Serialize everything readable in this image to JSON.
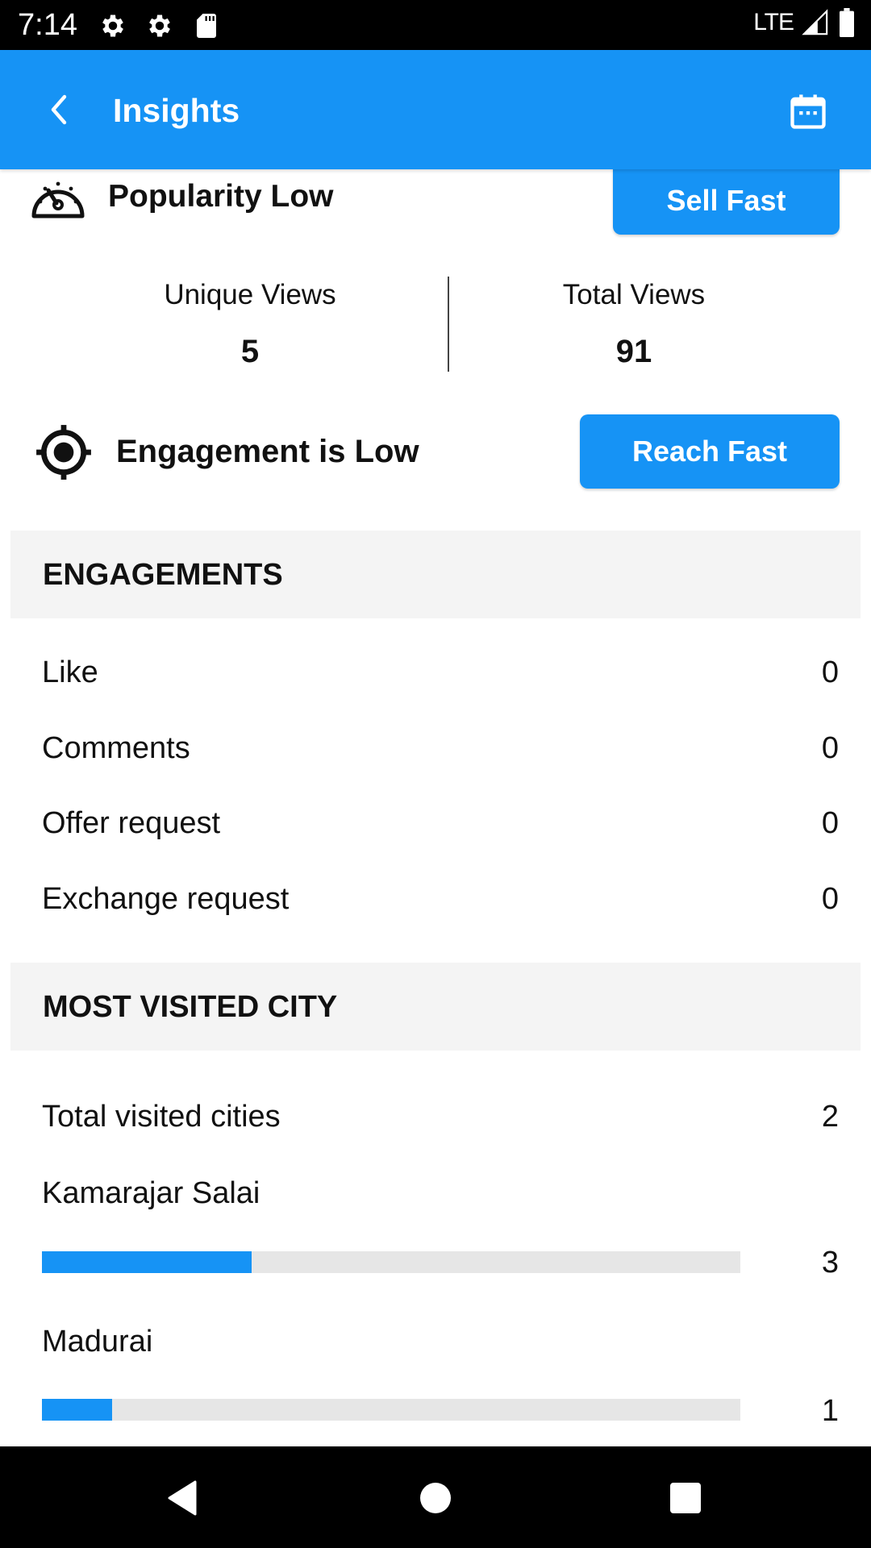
{
  "status_bar": {
    "time": "7:14",
    "left_icons": [
      "settings-icon",
      "settings-icon",
      "sd-card-icon"
    ],
    "network": "LTE",
    "right_icons": [
      "signal-icon",
      "battery-icon"
    ]
  },
  "app_bar": {
    "title": "Insights",
    "back_icon": "back-arrow-icon",
    "action_icon": "calendar-icon"
  },
  "popularity": {
    "icon": "speedometer-icon",
    "text": "Popularity Low",
    "button_label": "Sell Fast"
  },
  "views": {
    "unique_label": "Unique Views",
    "unique_value": "5",
    "total_label": "Total Views",
    "total_value": "91"
  },
  "engagement_status": {
    "icon": "target-icon",
    "text": "Engagement is Low",
    "button_label": "Reach Fast"
  },
  "engagements": {
    "header": "ENGAGEMENTS",
    "rows": [
      {
        "label": "Like",
        "value": "0"
      },
      {
        "label": "Comments",
        "value": "0"
      },
      {
        "label": "Offer request",
        "value": "0"
      },
      {
        "label": "Exchange request",
        "value": "0"
      }
    ]
  },
  "most_visited_city": {
    "header": "MOST VISITED CITY",
    "total_label": "Total visited cities",
    "total_value": "2",
    "cities": [
      {
        "name": "Kamarajar Salai",
        "value": "3",
        "progress": 0.3
      },
      {
        "name": "Madurai",
        "value": "1",
        "progress": 0.1
      }
    ]
  },
  "colors": {
    "accent": "#1693f5",
    "section_bg": "#f4f4f4",
    "bar_track": "#e6e6e6"
  },
  "nav_bar": {
    "buttons": [
      "back-icon",
      "home-icon",
      "recents-icon"
    ]
  }
}
